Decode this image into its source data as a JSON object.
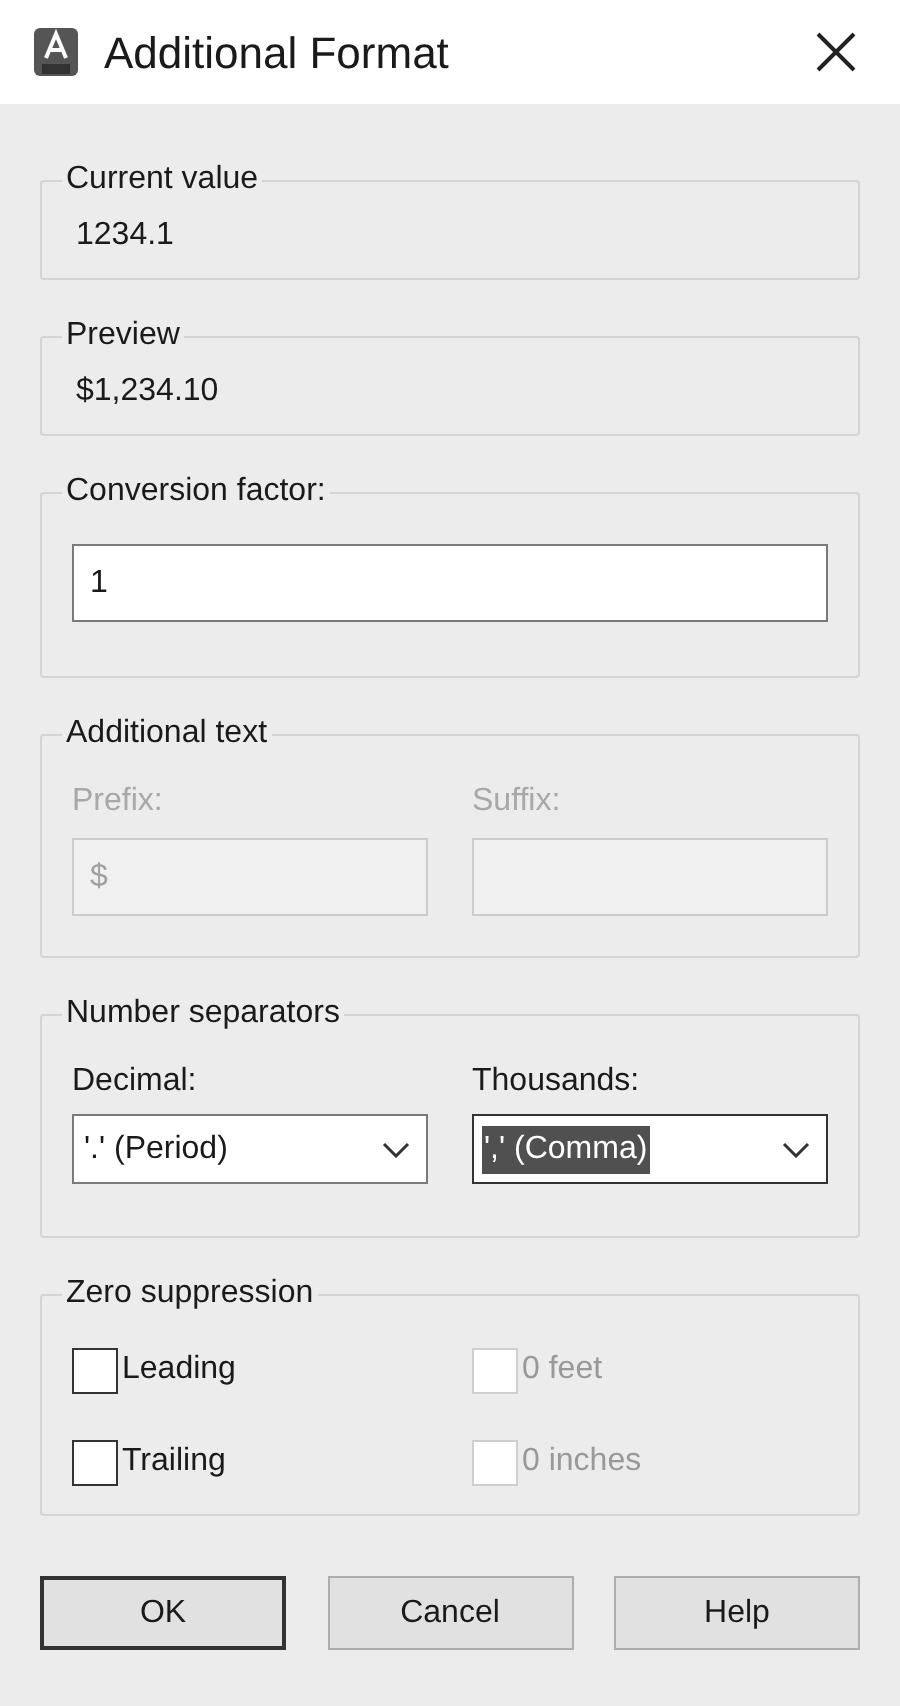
{
  "window": {
    "title": "Additional Format"
  },
  "current_value": {
    "label": "Current value",
    "value": "1234.1"
  },
  "preview": {
    "label": "Preview",
    "value": "$1,234.10"
  },
  "conversion_factor": {
    "label": "Conversion factor:",
    "value": "1"
  },
  "additional_text": {
    "label": "Additional text",
    "disabled": true,
    "fields": [
      {
        "label": "Prefix:",
        "value": "$"
      },
      {
        "label": "Suffix:"
      }
    ]
  },
  "number_separators": {
    "label": "Number separators",
    "fields": [
      {
        "label": "Decimal:",
        "value": "'.' (Period)",
        "selected": false
      },
      {
        "label": "Thousands:",
        "value": "',' (Comma)",
        "selected": true
      }
    ]
  },
  "zero_suppression": {
    "label": "Zero suppression",
    "options": [
      {
        "label": "Leading",
        "checked": false,
        "disabled": false
      },
      {
        "label": "0 feet",
        "checked": false,
        "disabled": true
      },
      {
        "label": "Trailing",
        "checked": false,
        "disabled": false
      },
      {
        "label": "0 inches",
        "checked": false,
        "disabled": true
      }
    ]
  },
  "buttons": [
    {
      "label": "OK",
      "default": true
    },
    {
      "label": "Cancel",
      "default": false
    },
    {
      "label": "Help",
      "default": false
    }
  ]
}
